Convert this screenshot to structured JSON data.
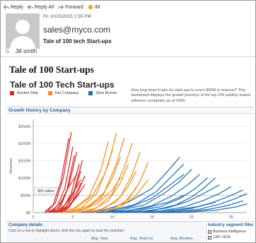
{
  "toolbar": {
    "reply": "Reply",
    "reply_all": "Reply All",
    "forward": "Forward",
    "im": "IM"
  },
  "email": {
    "date": "Fri 10/23/2015 1:55 PM",
    "sender": "sales@myco.com",
    "subject": "Tale of 100 tech Start-ups",
    "to_label": "To",
    "to": "Jill smith"
  },
  "body": {
    "title": "Tale of 100 Start-ups"
  },
  "dashboard": {
    "title": "Tale of 100 Tech Start-ups",
    "legend": [
      {
        "label": "Rocket Ship",
        "color": "#d62728"
      },
      {
        "label": "Hot Company",
        "color": "#f28e1c"
      },
      {
        "label": "Slow Burner",
        "color": "#1f6fb4"
      }
    ],
    "description": "How long does it take for start-ups to reach $50M in revenue? This dashboard displays the growth journeys of the top 100 publicly traded software companies as of 2009.",
    "section_title": "Growth History by Company",
    "company_details": {
      "title": "Company details",
      "subtitle": "Click on a row to highlight above; click the row again to clear the selection",
      "columns": [
        "Avg. Year",
        "Avg. Years to",
        "Avg. Revenu"
      ]
    },
    "filter": {
      "title": "Industry segment filter",
      "options": [
        {
          "label": "Business Intelligence",
          "checked": true
        },
        {
          "label": "CAD / EDA",
          "checked": true
        }
      ]
    }
  },
  "chart_data": {
    "type": "line",
    "ylabel": "Revenue",
    "xlabel": "",
    "xlim": [
      0,
      27
    ],
    "ylim": [
      0,
      270
    ],
    "x_ticks": [
      0,
      5,
      10,
      15,
      20,
      25
    ],
    "y_ticks": [
      {
        "value": 0,
        "label": "$0"
      },
      {
        "value": 50,
        "label": "$50M"
      },
      {
        "value": 100,
        "label": "$100M"
      },
      {
        "value": 150,
        "label": "$150M"
      },
      {
        "value": 200,
        "label": "$200M"
      },
      {
        "value": 250,
        "label": "$250M"
      }
    ],
    "reference_line": {
      "value": 50,
      "label": "$50 million"
    },
    "series_groups": [
      {
        "name": "Rocket Ship",
        "color": "#d62728",
        "lines": [
          {
            "x": [
              1.5,
              2.5,
              3.5,
              4.5
            ],
            "y": [
              3,
              22,
              90,
              215
            ]
          },
          {
            "x": [
              1.8,
              2.8,
              3.8,
              4.8
            ],
            "y": [
              4,
              28,
              100,
              232
            ]
          },
          {
            "x": [
              2,
              3,
              4,
              5
            ],
            "y": [
              2,
              18,
              70,
              190
            ]
          },
          {
            "x": [
              2.2,
              3.2,
              4.2,
              5.2
            ],
            "y": [
              2,
              14,
              60,
              165
            ]
          },
          {
            "x": [
              2.5,
              3.5,
              4.5,
              5.5
            ],
            "y": [
              3,
              20,
              78,
              175
            ]
          },
          {
            "x": [
              2.8,
              3.8,
              4.8,
              5.8
            ],
            "y": [
              2,
              15,
              55,
              140
            ]
          },
          {
            "x": [
              3,
              4,
              5,
              6
            ],
            "y": [
              2,
              12,
              45,
              120
            ]
          },
          {
            "x": [
              3.2,
              4.2,
              5.2,
              6.2
            ],
            "y": [
              3,
              18,
              65,
              150
            ]
          },
          {
            "x": [
              1.5,
              2.5,
              3.5,
              4.5,
              5.5
            ],
            "y": [
              1,
              8,
              30,
              75,
              110
            ]
          },
          {
            "x": [
              2,
              3,
              4,
              5,
              6
            ],
            "y": [
              1,
              6,
              22,
              55,
              95
            ]
          },
          {
            "x": [
              3.5,
              4.5,
              5.5,
              6.5
            ],
            "y": [
              2,
              14,
              50,
              105
            ]
          },
          {
            "x": [
              2.5,
              3.5,
              4.5,
              5.5,
              6.5
            ],
            "y": [
              1,
              5,
              18,
              45,
              80
            ]
          },
          {
            "x": [
              4,
              5,
              6
            ],
            "y": [
              6,
              35,
              85
            ]
          }
        ]
      },
      {
        "name": "Hot Company",
        "color": "#f28e1c",
        "lines": [
          {
            "x": [
              3,
              5,
              7,
              8.5,
              9.5
            ],
            "y": [
              1,
              10,
              45,
              120,
              205
            ]
          },
          {
            "x": [
              4,
              6,
              8,
              9.5,
              10.5
            ],
            "y": [
              1,
              12,
              55,
              140,
              230
            ]
          },
          {
            "x": [
              3.5,
              5.5,
              7.5,
              9,
              10
            ],
            "y": [
              2,
              14,
              50,
              110,
              180
            ]
          },
          {
            "x": [
              5,
              7,
              9,
              10.5,
              11.5
            ],
            "y": [
              2,
              15,
              60,
              140,
              215
            ]
          },
          {
            "x": [
              4.5,
              6.5,
              8.5,
              10,
              11
            ],
            "y": [
              1,
              10,
              40,
              100,
              160
            ]
          },
          {
            "x": [
              6,
              8,
              10,
              11.5,
              12.5
            ],
            "y": [
              2,
              14,
              55,
              130,
              200
            ]
          },
          {
            "x": [
              5.5,
              7.5,
              9.5,
              11,
              12
            ],
            "y": [
              1,
              8,
              35,
              85,
              140
            ]
          },
          {
            "x": [
              7,
              9,
              11,
              12.5,
              13.5
            ],
            "y": [
              2,
              12,
              45,
              110,
              175
            ]
          },
          {
            "x": [
              6.5,
              8.5,
              10.5,
              12,
              13
            ],
            "y": [
              1,
              9,
              32,
              75,
              120
            ]
          },
          {
            "x": [
              8,
              10,
              12,
              13.5,
              14.5
            ],
            "y": [
              2,
              10,
              38,
              90,
              145
            ]
          },
          {
            "x": [
              4,
              6,
              8,
              10,
              11
            ],
            "y": [
              1,
              6,
              25,
              65,
              100
            ]
          },
          {
            "x": [
              9,
              11,
              13,
              14.5
            ],
            "y": [
              3,
              16,
              50,
              95
            ]
          },
          {
            "x": [
              7.5,
              9.5,
              11.5,
              13
            ],
            "y": [
              1,
              7,
              28,
              70
            ]
          },
          {
            "x": [
              3,
              5,
              7,
              9
            ],
            "y": [
              1,
              5,
              20,
              55
            ]
          }
        ]
      },
      {
        "name": "Slow Burner",
        "color": "#1f6fb4",
        "lines": [
          {
            "x": [
              6,
              9,
              12,
              15,
              17,
              18.5
            ],
            "y": [
              1,
              8,
              30,
              70,
              120,
              160
            ]
          },
          {
            "x": [
              7,
              10,
              13,
              15.5,
              17.5,
              19
            ],
            "y": [
              1,
              6,
              25,
              60,
              105,
              140
            ]
          },
          {
            "x": [
              8,
              11,
              14,
              16.5,
              18.5,
              20
            ],
            "y": [
              1,
              7,
              22,
              55,
              90,
              125
            ]
          },
          {
            "x": [
              6.5,
              9.5,
              12.5,
              15,
              17,
              19
            ],
            "y": [
              0,
              5,
              18,
              42,
              75,
              110
            ]
          },
          {
            "x": [
              9,
              12,
              15,
              17.5,
              19.5,
              21
            ],
            "y": [
              1,
              6,
              20,
              48,
              80,
              110
            ]
          },
          {
            "x": [
              10,
              13,
              16,
              18.5,
              20.5,
              22
            ],
            "y": [
              1,
              5,
              17,
              40,
              70,
              100
            ]
          },
          {
            "x": [
              12,
              15,
              18,
              20,
              21.5,
              23
            ],
            "y": [
              1,
              6,
              22,
              45,
              70,
              100
            ]
          },
          {
            "x": [
              11,
              14,
              17,
              19.5,
              21.5,
              23.5
            ],
            "y": [
              0,
              4,
              14,
              32,
              55,
              80
            ]
          },
          {
            "x": [
              13,
              16,
              19,
              21.5,
              23.5,
              25
            ],
            "y": [
              1,
              5,
              16,
              35,
              55,
              75
            ]
          },
          {
            "x": [
              14,
              17,
              20,
              22.5,
              24.5,
              26.5
            ],
            "y": [
              0,
              3,
              12,
              28,
              45,
              65
            ]
          },
          {
            "x": [
              15,
              18,
              21,
              23.5,
              25.5,
              27
            ],
            "y": [
              0,
              3,
              10,
              24,
              40,
              55
            ]
          },
          {
            "x": [
              8,
              11,
              14,
              17,
              19
            ],
            "y": [
              0,
              3,
              12,
              30,
              50
            ]
          },
          {
            "x": [
              16,
              19,
              22,
              24.5,
              26.5
            ],
            "y": [
              0,
              2,
              9,
              20,
              34
            ]
          },
          {
            "x": [
              17,
              20,
              23,
              25.5,
              27
            ],
            "y": [
              0,
              2,
              7,
              16,
              25
            ]
          },
          {
            "x": [
              10,
              14,
              18,
              21,
              23
            ],
            "y": [
              0,
              2,
              8,
              18,
              30
            ]
          }
        ]
      }
    ]
  }
}
